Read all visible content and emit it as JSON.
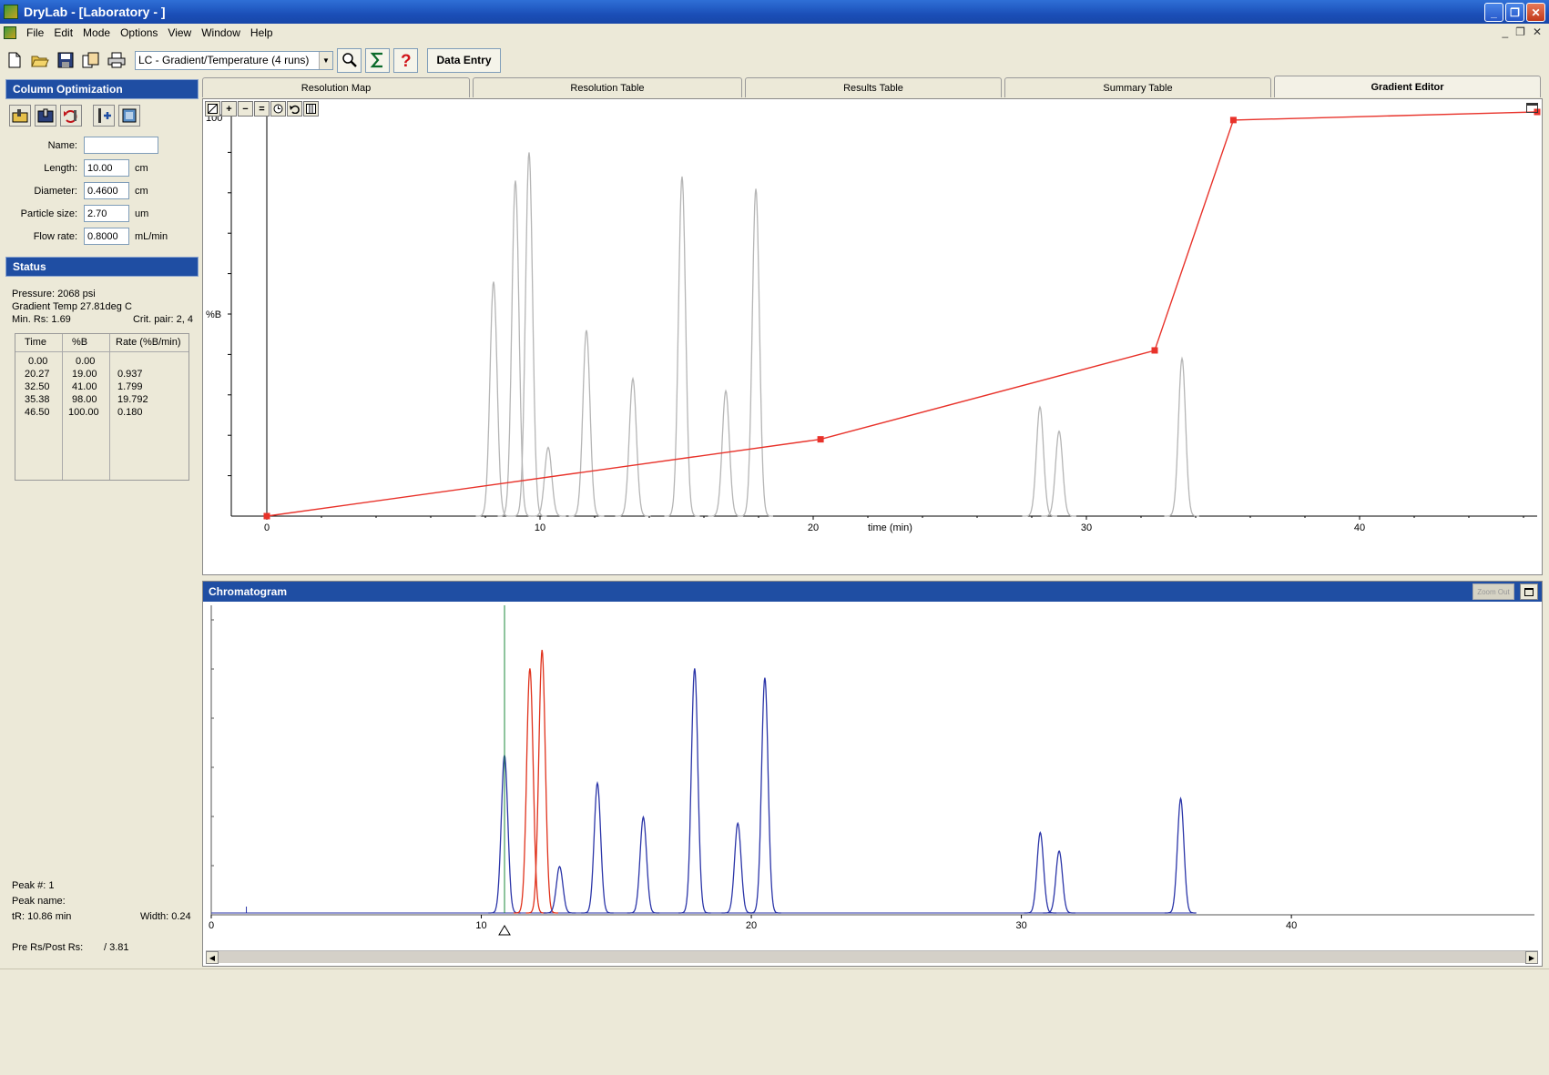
{
  "window": {
    "title": "DryLab - [Laboratory - ]",
    "minimize": "_",
    "restore": "❐",
    "close": "✕"
  },
  "menu": {
    "items": [
      "File",
      "Edit",
      "Mode",
      "Options",
      "View",
      "Window",
      "Help"
    ],
    "mdi_min": "_",
    "mdi_restore": "❐",
    "mdi_close": "✕"
  },
  "toolbar": {
    "mode_select": "LC - Gradient/Temperature (4 runs)",
    "data_entry": "Data Entry",
    "icons": [
      "new-file-icon",
      "open-folder-icon",
      "save-icon",
      "copy-icon",
      "print-icon",
      "zoom-icon",
      "sigma-icon",
      "help-icon"
    ]
  },
  "column_optimization": {
    "title": "Column Optimization",
    "fields": [
      {
        "label": "Name:",
        "value": "",
        "unit": ""
      },
      {
        "label": "Length:",
        "value": "10.00",
        "unit": "cm"
      },
      {
        "label": "Diameter:",
        "value": "0.4600",
        "unit": "cm"
      },
      {
        "label": "Particle size:",
        "value": "2.70",
        "unit": "um"
      },
      {
        "label": "Flow rate:",
        "value": "0.8000",
        "unit": "mL/min"
      }
    ]
  },
  "status": {
    "title": "Status",
    "pressure": "Pressure: 2068 psi",
    "gradient_temp": "Gradient Temp 27.81deg C",
    "min_rs": "Min. Rs: 1.69",
    "crit_pair": "Crit. pair: 2, 4",
    "table": {
      "headers": [
        "Time",
        "%B",
        "Rate (%B/min)"
      ],
      "rows": [
        [
          "0.00",
          "0.00",
          ""
        ],
        [
          "20.27",
          "19.00",
          "0.937"
        ],
        [
          "32.50",
          "41.00",
          "1.799"
        ],
        [
          "35.38",
          "98.00",
          "19.792"
        ],
        [
          "46.50",
          "100.00",
          "0.180"
        ]
      ]
    },
    "peak_num": "Peak #:  1",
    "peak_name": "Peak name:",
    "tr": "tR:  10.86 min",
    "width": "Width: 0.24",
    "pre_post_rs": "Pre Rs/Post Rs:",
    "pre_post_rs_value": "/ 3.81"
  },
  "tabs": [
    {
      "label": "Resolution Map",
      "active": false
    },
    {
      "label": "Resolution Table",
      "active": false
    },
    {
      "label": "Results Table",
      "active": false
    },
    {
      "label": "Summary Table",
      "active": false
    },
    {
      "label": "Gradient Editor",
      "active": true
    }
  ],
  "gradient_editor": {
    "y_top_label": "100",
    "y_label": "%B",
    "x_label": "time (min)",
    "x_ticks": [
      "0",
      "10",
      "20",
      "30",
      "40"
    ],
    "toolbar_buttons": [
      "+",
      "−",
      "="
    ]
  },
  "chromatogram": {
    "title": "Chromatogram",
    "zoom_label": "Zoom Out",
    "x_ticks": [
      "0",
      "10",
      "20",
      "30",
      "40"
    ]
  },
  "chart_data": [
    {
      "type": "line",
      "name": "gradient-program",
      "x": [
        0.0,
        20.27,
        32.5,
        35.38,
        46.5
      ],
      "y": [
        0.0,
        19.0,
        41.0,
        98.0,
        100.0
      ],
      "xlim": [
        -1.3,
        46.5
      ],
      "ylim": [
        0,
        100
      ],
      "color": "#e8322a",
      "background_peaks": [
        {
          "rt": 8.3,
          "h": 0.58
        },
        {
          "rt": 9.1,
          "h": 0.83
        },
        {
          "rt": 9.6,
          "h": 0.9
        },
        {
          "rt": 10.3,
          "h": 0.17
        },
        {
          "rt": 11.7,
          "h": 0.46
        },
        {
          "rt": 13.4,
          "h": 0.34
        },
        {
          "rt": 15.2,
          "h": 0.84
        },
        {
          "rt": 16.8,
          "h": 0.31
        },
        {
          "rt": 17.9,
          "h": 0.81
        },
        {
          "rt": 28.3,
          "h": 0.27
        },
        {
          "rt": 29.0,
          "h": 0.21
        },
        {
          "rt": 33.5,
          "h": 0.39
        }
      ],
      "peak_color": "#b5b5b5"
    },
    {
      "type": "line",
      "name": "chromatogram",
      "xlim": [
        0,
        49
      ],
      "peaks": [
        {
          "rt": 10.86,
          "h": 0.51,
          "color": "#2b35a8"
        },
        {
          "rt": 11.8,
          "h": 0.79,
          "color": "#e0321c"
        },
        {
          "rt": 12.25,
          "h": 0.85,
          "color": "#e0321c"
        },
        {
          "rt": 12.9,
          "h": 0.15,
          "color": "#2b35a8"
        },
        {
          "rt": 14.3,
          "h": 0.42,
          "color": "#2b35a8"
        },
        {
          "rt": 16.0,
          "h": 0.31,
          "color": "#2b35a8"
        },
        {
          "rt": 17.9,
          "h": 0.79,
          "color": "#2b35a8"
        },
        {
          "rt": 19.5,
          "h": 0.29,
          "color": "#2b35a8"
        },
        {
          "rt": 20.5,
          "h": 0.76,
          "color": "#2b35a8"
        },
        {
          "rt": 30.7,
          "h": 0.26,
          "color": "#2b35a8"
        },
        {
          "rt": 31.4,
          "h": 0.2,
          "color": "#2b35a8"
        },
        {
          "rt": 35.9,
          "h": 0.37,
          "color": "#2b35a8"
        }
      ],
      "marker_rt": 10.86,
      "marker_color": "#1e8a3c"
    }
  ]
}
